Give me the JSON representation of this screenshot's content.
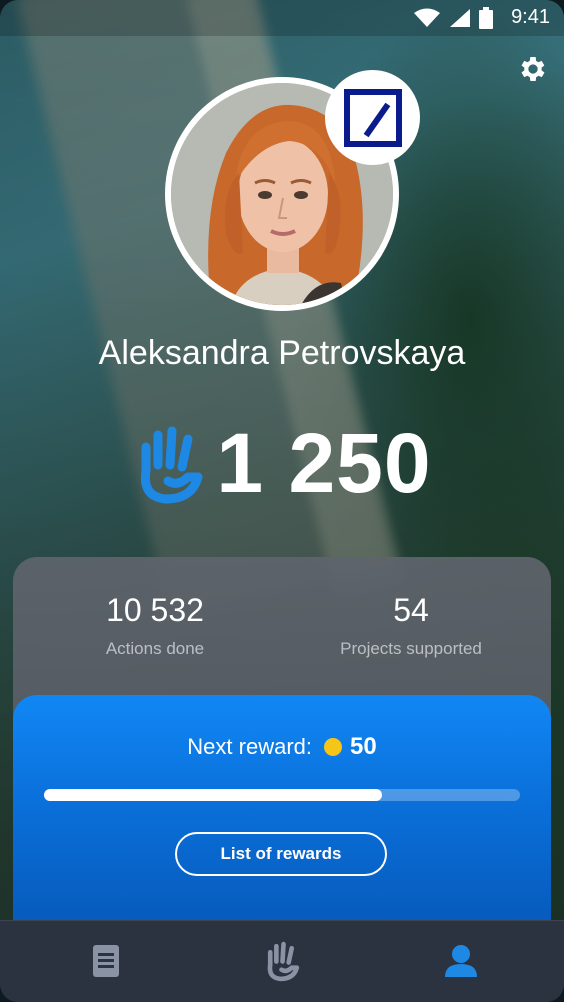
{
  "status_bar": {
    "time": "9:41",
    "icons": [
      "wifi-icon",
      "signal-icon",
      "battery-icon"
    ]
  },
  "header": {
    "settings_icon": "gear-icon"
  },
  "profile": {
    "name": "Aleksandra Petrovskaya",
    "organization_badge": "deutsche-bank-logo",
    "points": "1 250",
    "points_icon": "hand-icon"
  },
  "stats": {
    "actions": {
      "value": "10 532",
      "label": "Actions done"
    },
    "projects": {
      "value": "54",
      "label": "Projects supported"
    }
  },
  "reward": {
    "label": "Next reward:",
    "value": "50",
    "coin_icon": "coin-icon",
    "progress": 0.71,
    "button_label": "List of rewards"
  },
  "nav": {
    "items": [
      {
        "icon": "document-icon",
        "active": false
      },
      {
        "icon": "hand-icon",
        "active": false
      },
      {
        "icon": "person-icon",
        "active": true
      }
    ]
  },
  "colors": {
    "accent": "#1e88e5",
    "card_blue": "#0a6fd9",
    "coin": "#f5c518",
    "nav_bg": "#2c3340"
  }
}
